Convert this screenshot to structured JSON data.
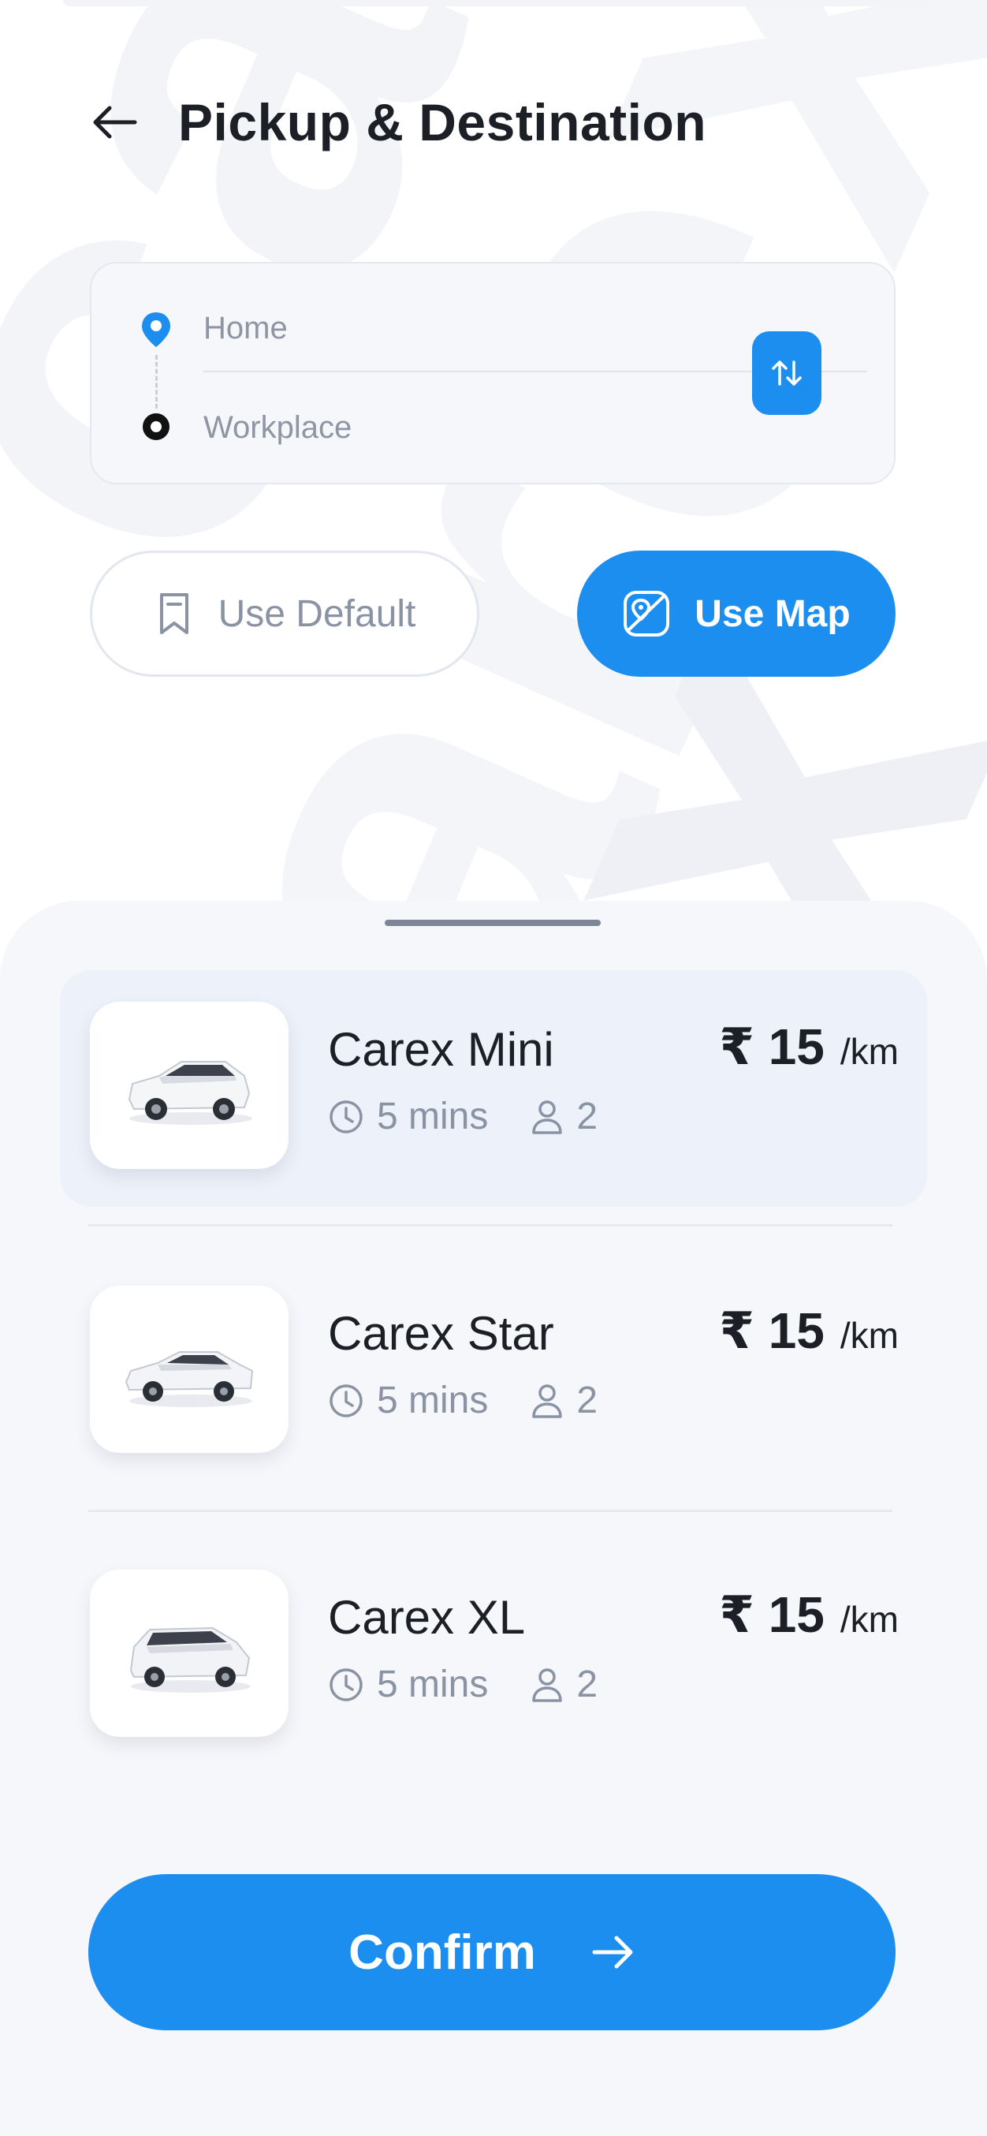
{
  "header": {
    "title": "Pickup & Destination",
    "back_icon": "arrow-left-icon"
  },
  "route": {
    "pickup": "Home",
    "destination": "Workplace",
    "swap_icon": "swap-vertical-icon"
  },
  "actions": {
    "use_default_label": "Use Default",
    "use_map_label": "Use Map"
  },
  "rides": [
    {
      "name": "Carex Mini",
      "eta": "5 mins",
      "seats": "2",
      "price": "₹ 15",
      "unit": "/km",
      "selected": true
    },
    {
      "name": "Carex Star",
      "eta": "5 mins",
      "seats": "2",
      "price": "₹ 15",
      "unit": "/km",
      "selected": false
    },
    {
      "name": "Carex XL",
      "eta": "5 mins",
      "seats": "2",
      "price": "₹ 15",
      "unit": "/km",
      "selected": false
    }
  ],
  "confirm": {
    "label": "Confirm"
  },
  "watermark": "carex",
  "colors": {
    "accent": "#1c8ef0",
    "text_primary": "#1c1f26",
    "text_muted": "#8a93a3",
    "selected_row": "#edf1fa",
    "sheet": "#f6f7fb"
  }
}
